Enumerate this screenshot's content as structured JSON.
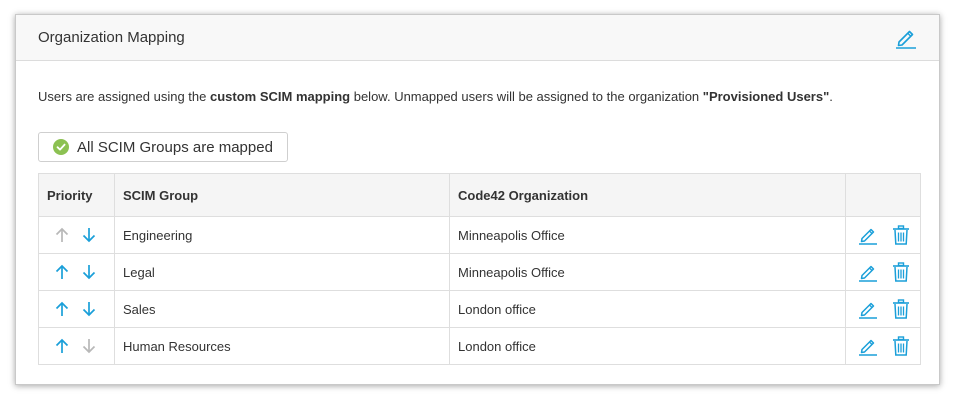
{
  "panel": {
    "title": "Organization Mapping",
    "edit_icon": "pencil-icon"
  },
  "description": {
    "part1": "Users are assigned using the ",
    "bold1": "custom SCIM mapping",
    "part2": " below.  Unmapped users will be assigned to the organization ",
    "bold2": "\"Provisioned Users\"",
    "part3": "."
  },
  "status": {
    "label": "All SCIM Groups are mapped",
    "icon": "check-circle-icon",
    "color": "#8cc152"
  },
  "table": {
    "headers": {
      "priority": "Priority",
      "group": "SCIM Group",
      "org": "Code42 Organization",
      "actions": ""
    },
    "rows": [
      {
        "group": "Engineering",
        "org": "Minneapolis Office",
        "up_enabled": false,
        "down_enabled": true
      },
      {
        "group": "Legal",
        "org": "Minneapolis Office",
        "up_enabled": true,
        "down_enabled": true
      },
      {
        "group": "Sales",
        "org": "London office",
        "up_enabled": true,
        "down_enabled": true
      },
      {
        "group": "Human Resources",
        "org": "London office",
        "up_enabled": true,
        "down_enabled": false
      }
    ]
  },
  "colors": {
    "accent": "#1a9fd9",
    "disabled": "#b8b8b8"
  }
}
